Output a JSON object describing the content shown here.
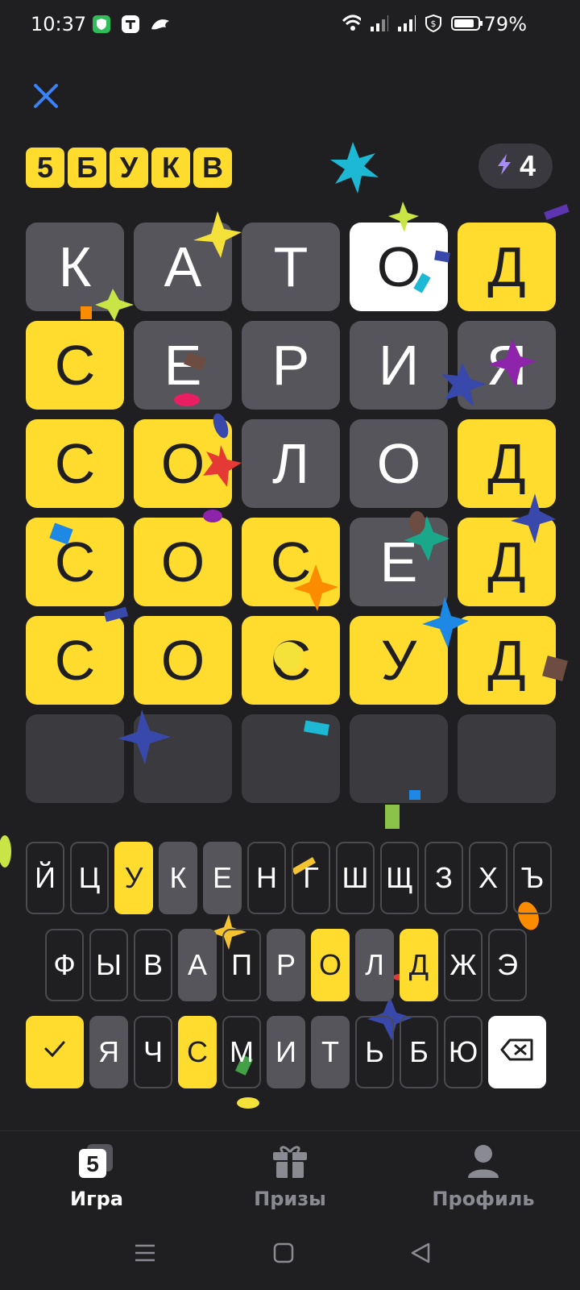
{
  "status_bar": {
    "time": "10:37",
    "battery": "79%",
    "icons": [
      "shield-app-icon",
      "t-app-icon",
      "dragon-app-icon",
      "wifi-icon",
      "signal-icon",
      "signal-icon",
      "data-saver-icon",
      "battery-icon"
    ]
  },
  "header": {
    "close_icon": "close-icon",
    "logo_letters": [
      "5",
      "Б",
      "У",
      "К",
      "В"
    ],
    "energy_count": "4",
    "energy_icon": "lightning-icon"
  },
  "board": {
    "rows": [
      [
        {
          "l": "К",
          "s": "gray"
        },
        {
          "l": "А",
          "s": "gray"
        },
        {
          "l": "Т",
          "s": "gray"
        },
        {
          "l": "О",
          "s": "white"
        },
        {
          "l": "Д",
          "s": "yellow"
        }
      ],
      [
        {
          "l": "С",
          "s": "yellow"
        },
        {
          "l": "Е",
          "s": "gray"
        },
        {
          "l": "Р",
          "s": "gray"
        },
        {
          "l": "И",
          "s": "gray"
        },
        {
          "l": "Я",
          "s": "gray"
        }
      ],
      [
        {
          "l": "С",
          "s": "yellow"
        },
        {
          "l": "О",
          "s": "yellow"
        },
        {
          "l": "Л",
          "s": "gray"
        },
        {
          "l": "О",
          "s": "gray"
        },
        {
          "l": "Д",
          "s": "yellow"
        }
      ],
      [
        {
          "l": "С",
          "s": "yellow"
        },
        {
          "l": "О",
          "s": "yellow"
        },
        {
          "l": "С",
          "s": "yellow"
        },
        {
          "l": "Е",
          "s": "gray"
        },
        {
          "l": "Д",
          "s": "yellow"
        }
      ],
      [
        {
          "l": "С",
          "s": "yellow"
        },
        {
          "l": "О",
          "s": "yellow"
        },
        {
          "l": "С",
          "s": "yellow"
        },
        {
          "l": "У",
          "s": "yellow"
        },
        {
          "l": "Д",
          "s": "yellow"
        }
      ],
      [
        {
          "l": "",
          "s": "empty"
        },
        {
          "l": "",
          "s": "empty"
        },
        {
          "l": "",
          "s": "empty"
        },
        {
          "l": "",
          "s": "empty"
        },
        {
          "l": "",
          "s": "empty"
        }
      ]
    ]
  },
  "keyboard": {
    "row1": [
      {
        "k": "Й",
        "s": ""
      },
      {
        "k": "Ц",
        "s": ""
      },
      {
        "k": "У",
        "s": "y"
      },
      {
        "k": "К",
        "s": "g"
      },
      {
        "k": "Е",
        "s": "g"
      },
      {
        "k": "Н",
        "s": ""
      },
      {
        "k": "Г",
        "s": ""
      },
      {
        "k": "Ш",
        "s": ""
      },
      {
        "k": "Щ",
        "s": ""
      },
      {
        "k": "З",
        "s": ""
      },
      {
        "k": "Х",
        "s": ""
      },
      {
        "k": "Ъ",
        "s": ""
      }
    ],
    "row2": [
      {
        "k": "Ф",
        "s": ""
      },
      {
        "k": "Ы",
        "s": ""
      },
      {
        "k": "В",
        "s": ""
      },
      {
        "k": "А",
        "s": "g"
      },
      {
        "k": "П",
        "s": ""
      },
      {
        "k": "Р",
        "s": "g"
      },
      {
        "k": "О",
        "s": "y"
      },
      {
        "k": "Л",
        "s": "g"
      },
      {
        "k": "Д",
        "s": "y"
      },
      {
        "k": "Ж",
        "s": ""
      },
      {
        "k": "Э",
        "s": ""
      }
    ],
    "row3": [
      {
        "k": "Я",
        "s": "g"
      },
      {
        "k": "Ч",
        "s": ""
      },
      {
        "k": "С",
        "s": "y"
      },
      {
        "k": "М",
        "s": ""
      },
      {
        "k": "И",
        "s": "g"
      },
      {
        "k": "Т",
        "s": "g"
      },
      {
        "k": "Ь",
        "s": ""
      },
      {
        "k": "Б",
        "s": ""
      },
      {
        "k": "Ю",
        "s": ""
      }
    ],
    "enter_icon": "checkmark-icon",
    "backspace_icon": "backspace-icon"
  },
  "tabs": [
    {
      "label": "Игра",
      "icon": "game-icon",
      "active": true
    },
    {
      "label": "Призы",
      "icon": "gift-icon",
      "active": false
    },
    {
      "label": "Профиль",
      "icon": "profile-icon",
      "active": false
    }
  ],
  "nav": [
    "menu-icon",
    "home-icon",
    "back-icon"
  ],
  "colors": {
    "background": "#1f1f21",
    "yellow": "#ffdc2e",
    "gray": "#55555b",
    "accent": "#3b82f6"
  }
}
